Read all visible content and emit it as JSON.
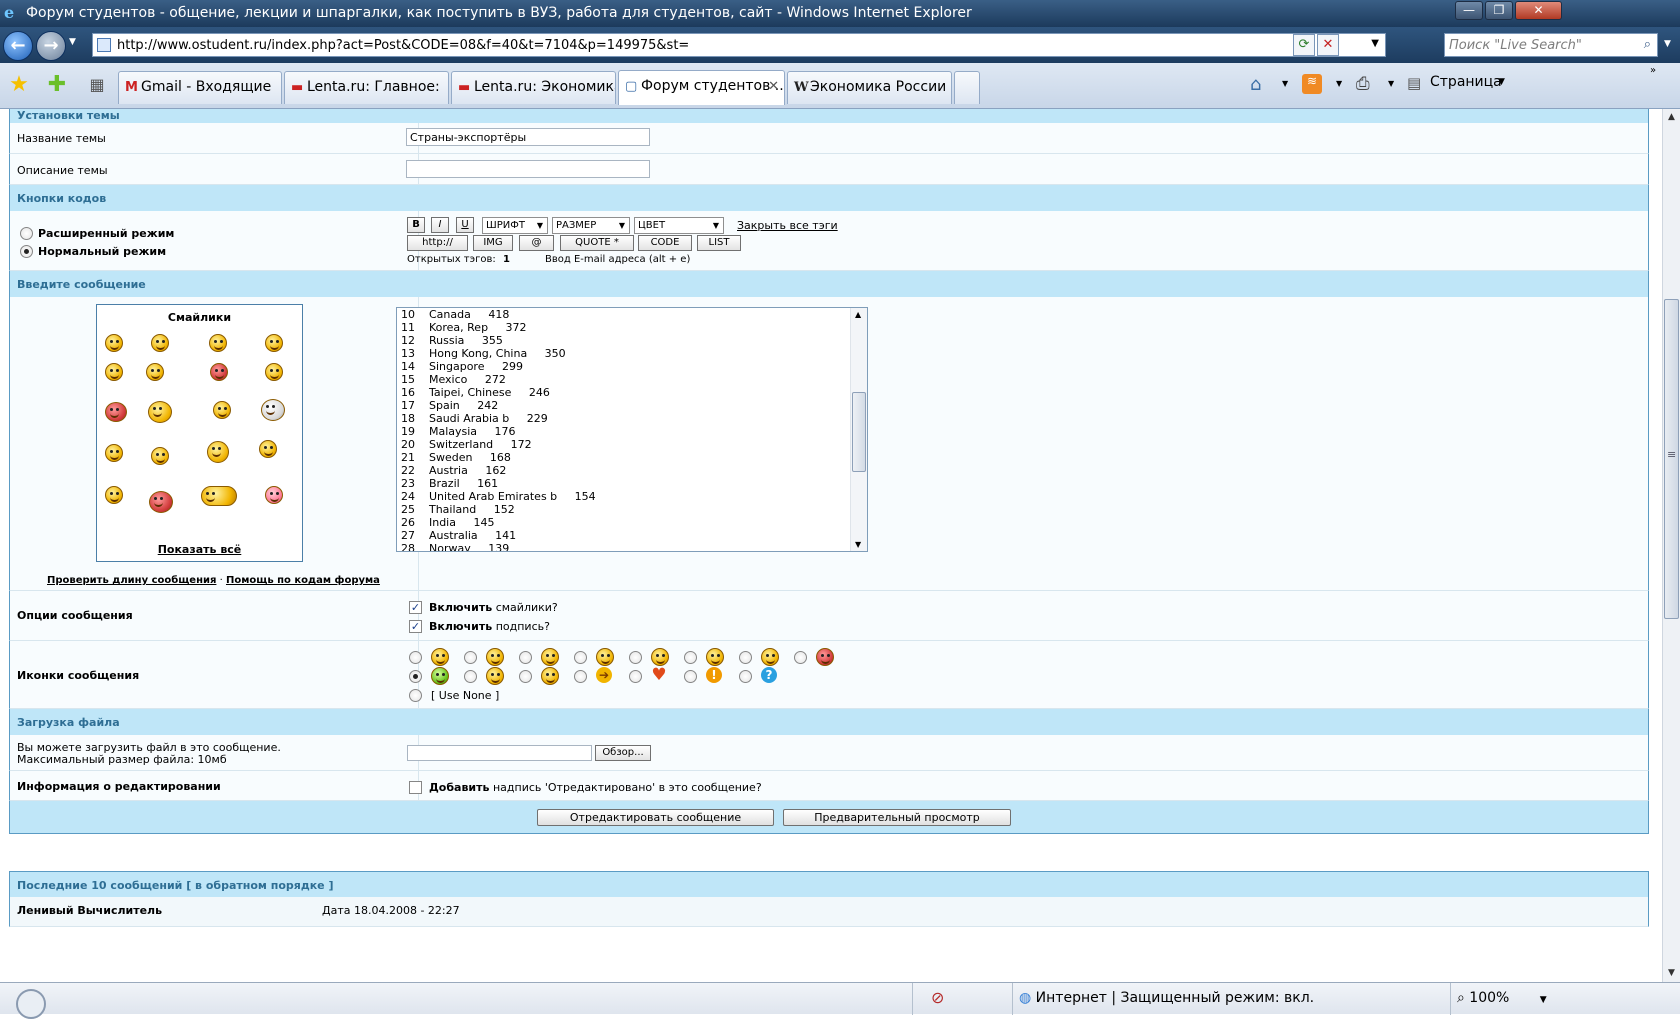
{
  "window": {
    "title": "Форум студентов - общение, лекции и шпаргалки, как поступить в ВУЗ, работа для студентов, сайт  - Windows Internet Explorer",
    "minimize": "—",
    "maximize": "❐",
    "close": "✕"
  },
  "address": {
    "url": "http://www.ostudent.ru/index.php?act=Post&CODE=08&f=40&t=7104&p=149975&st=",
    "search_placeholder": "Поиск \"Live Search\""
  },
  "tabs": [
    {
      "label": "Gmail - Входящие",
      "icon": "M"
    },
    {
      "label": "Lenta.ru: Главное:",
      "icon": "▬"
    },
    {
      "label": "Lenta.ru: Экономика:...",
      "icon": "▬"
    },
    {
      "label": "Форум студентов ...",
      "icon": "▢",
      "active": true
    },
    {
      "label": "Экономика России ...",
      "icon": "W"
    }
  ],
  "toolbar": {
    "page_label": "Страница"
  },
  "sections": {
    "topic_settings": "Установки темы",
    "code_buttons": "Кнопки кодов",
    "enter_message": "Введите сообщение",
    "file_upload": "Загрузка файла",
    "last_posts": "Последние 10 сообщений [ в обратном порядке ]"
  },
  "topic": {
    "title_label": "Название темы",
    "title_value": "Страны-экспортёры",
    "desc_label": "Описание темы",
    "desc_value": ""
  },
  "modes": {
    "extended": "Расширенный режим",
    "normal": "Нормальный режим"
  },
  "codebuttons": {
    "bold": "B",
    "italic": "I",
    "underline": "U",
    "font": "ШРИФТ",
    "size": "РАЗМЕР",
    "color": "ЦВЕТ",
    "close_all": "Закрыть все тэги",
    "http": "http://",
    "img": "IMG",
    "at": "@",
    "quote": "QUOTE *",
    "code": "CODE",
    "list": "LIST",
    "open_tags_label": "Открытых тэгов:",
    "open_tags_count": "1",
    "hint": "Ввод E-mail адреса (alt + e)"
  },
  "smilies": {
    "title": "Смайлики",
    "show_all": "Показать всё",
    "check_length": "Проверить длину сообщения",
    "separator": "·",
    "help": "Помощь по кодам форума"
  },
  "message_lines": [
    "10    Canada     418",
    "11    Korea, Rep     372",
    "12    Russia     355",
    "13    Hong Kong, China     350",
    "14    Singapore     299",
    "15    Mexico     272",
    "16    Taipei, Chinese     246",
    "17    Spain     242",
    "18    Saudi Arabia b     229",
    "19    Malaysia     176",
    "20    Switzerland     172",
    "21    Sweden     168",
    "22    Austria     162",
    "23    Brazil     161",
    "24    United Arab Emirates b     154",
    "25    Thailand     152",
    "26    India     145",
    "27    Australia     141",
    "28    Norway     139"
  ],
  "options": {
    "label": "Опции сообщения",
    "smilies_bold": "Включить",
    "smilies_rest": "смайлики?",
    "sig_bold": "Включить",
    "sig_rest": "подпись?"
  },
  "post_icons": {
    "label": "Иконки сообщения",
    "use_none": "[ Use None ]"
  },
  "upload": {
    "text1": "Вы можете загрузить файл в это сообщение.",
    "text2": "Максимальный размер файла: 10мб",
    "browse": "Обзор..."
  },
  "edit_info": {
    "label": "Информация о редактировании",
    "add_bold": "Добавить",
    "add_rest": "надпись 'Отредактировано' в это сообщение?"
  },
  "buttons": {
    "submit": "Отредактировать сообщение",
    "preview": "Предварительный просмотр"
  },
  "last_post": {
    "author": "Ленивый Вычислитель",
    "date": "Дата 18.04.2008 - 22:27"
  },
  "status": {
    "zone": "Интернет | Защищенный режим: вкл.",
    "zoom": "100%"
  }
}
